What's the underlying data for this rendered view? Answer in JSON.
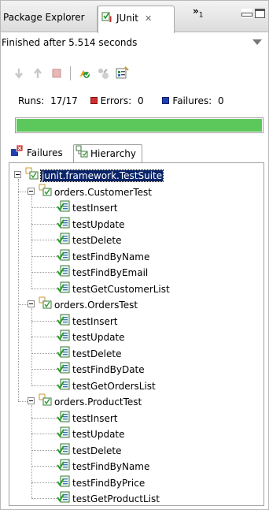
{
  "tabs": {
    "package_explorer": "Package Explorer",
    "junit": "JUnit",
    "junit_close": "✕",
    "overflow": "»",
    "overflow_count": "1"
  },
  "status": "Finished after 5.514 seconds",
  "counters": {
    "runs_label": "Runs:",
    "runs_value": "17/17",
    "errors_label": "Errors:",
    "errors_value": "0",
    "failures_label": "Failures:",
    "failures_value": "0"
  },
  "progress": {
    "fraction": 1.0,
    "color": "#5cc85c"
  },
  "lower_tabs": {
    "failures": "Failures",
    "hierarchy": "Hierarchy"
  },
  "tree": {
    "root": "junit.framework.TestSuite",
    "suites": [
      {
        "name": "orders.CustomerTest",
        "tests": [
          "testInsert",
          "testUpdate",
          "testDelete",
          "testFindByName",
          "testFindByEmail",
          "testGetCustomerList"
        ]
      },
      {
        "name": "orders.OrdersTest",
        "tests": [
          "testInsert",
          "testUpdate",
          "testDelete",
          "testFindByDate",
          "testGetOrdersList"
        ]
      },
      {
        "name": "orders.ProductTest",
        "tests": [
          "testInsert",
          "testUpdate",
          "testDelete",
          "testFindByName",
          "testFindByPrice",
          "testGetProductList"
        ]
      }
    ]
  },
  "icons": {
    "toolbar": [
      "next-failure-icon",
      "previous-failure-icon",
      "stop-icon",
      "rerun-icon",
      "rerun-failed-icon",
      "test-history-icon"
    ]
  },
  "colors": {
    "selection": "#0a246a",
    "pass": "#3aa03a",
    "error": "#d03030",
    "failure": "#2040b0"
  }
}
